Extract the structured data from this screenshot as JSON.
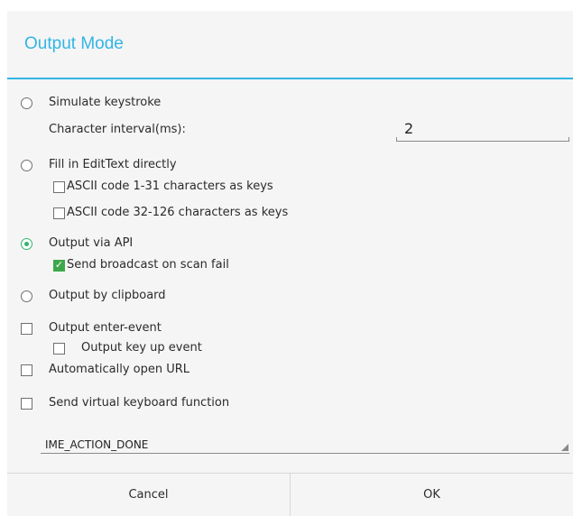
{
  "dialog": {
    "title": "Output Mode",
    "options": {
      "simulate_keystroke": "Simulate keystroke",
      "character_interval_label": "Character interval(ms):",
      "character_interval_value": "2",
      "fill_edittext": "Fill in EditText directly",
      "ascii_1_31": "ASCII code 1-31 characters as keys",
      "ascii_32_126": "ASCII code 32-126 characters as keys",
      "output_via_api": "Output via API",
      "send_broadcast": "Send broadcast on scan fail",
      "output_clipboard": "Output by clipboard",
      "output_enter_event": "Output enter-event",
      "output_key_up": "Output key up event",
      "auto_open_url": "Automatically open URL",
      "send_virtual_keyboard": "Send virtual keyboard function",
      "ime_action": "IME_ACTION_DONE"
    },
    "buttons": {
      "cancel": "Cancel",
      "ok": "OK"
    }
  },
  "state": {
    "selected_mode": "output_via_api",
    "send_broadcast_checked": true,
    "ascii_1_31_checked": false,
    "ascii_32_126_checked": false,
    "output_enter_event_checked": false,
    "output_key_up_checked": false,
    "auto_open_url_checked": false,
    "send_virtual_keyboard_checked": false
  },
  "colors": {
    "accent": "#33b5e5",
    "radio_checked": "#33b56e",
    "checkbox_checked": "#3da84a"
  }
}
